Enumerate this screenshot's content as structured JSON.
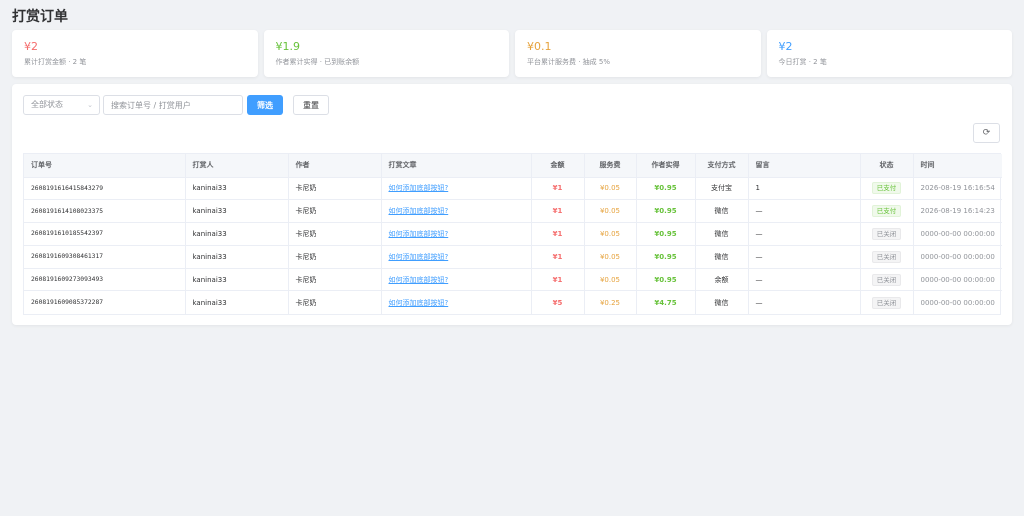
{
  "page": {
    "title": "打赏订单"
  },
  "stats": [
    {
      "value": "¥2",
      "desc": "累计打赏金额 · 2 笔",
      "color": "#f56c6c"
    },
    {
      "value": "¥1.9",
      "desc": "作者累计实得 · 已到账余额",
      "color": "#67c23a"
    },
    {
      "value": "¥0.1",
      "desc": "平台累计服务费 · 抽成 5%",
      "color": "#e6a23c"
    },
    {
      "value": "¥2",
      "desc": "今日打赏 · 2 笔",
      "color": "#409eff"
    }
  ],
  "filters": {
    "status_selected": "全部状态",
    "search_placeholder": "搜索订单号 / 打赏用户",
    "search_value": "",
    "filter_label": "筛选",
    "reset_label": "重置",
    "refresh_icon": "refresh-icon"
  },
  "table": {
    "columns": [
      "订单号",
      "打赏人",
      "作者",
      "打赏文章",
      "金额",
      "服务费",
      "作者实得",
      "支付方式",
      "留言",
      "状态",
      "时间"
    ],
    "rows": [
      {
        "order_no": "2608191616415843279",
        "tipper": "kaninai33",
        "author": "卡尼奶",
        "article": "如何添加底部按钮?",
        "amount": "¥1",
        "fee": "¥0.05",
        "net": "¥0.95",
        "pay": "支付宝",
        "message": "1",
        "status": "已支付",
        "status_type": "paid",
        "time": "2026-08-19 16:16:54"
      },
      {
        "order_no": "2608191614108023375",
        "tipper": "kaninai33",
        "author": "卡尼奶",
        "article": "如何添加底部按钮?",
        "amount": "¥1",
        "fee": "¥0.05",
        "net": "¥0.95",
        "pay": "微信",
        "message": "—",
        "status": "已支付",
        "status_type": "paid",
        "time": "2026-08-19 16:14:23"
      },
      {
        "order_no": "2608191610185542397",
        "tipper": "kaninai33",
        "author": "卡尼奶",
        "article": "如何添加底部按钮?",
        "amount": "¥1",
        "fee": "¥0.05",
        "net": "¥0.95",
        "pay": "微信",
        "message": "—",
        "status": "已关闭",
        "status_type": "closed",
        "time": "0000-00-00 00:00:00"
      },
      {
        "order_no": "2608191609308461317",
        "tipper": "kaninai33",
        "author": "卡尼奶",
        "article": "如何添加底部按钮?",
        "amount": "¥1",
        "fee": "¥0.05",
        "net": "¥0.95",
        "pay": "微信",
        "message": "—",
        "status": "已关闭",
        "status_type": "closed",
        "time": "0000-00-00 00:00:00"
      },
      {
        "order_no": "2608191609273093493",
        "tipper": "kaninai33",
        "author": "卡尼奶",
        "article": "如何添加底部按钮?",
        "amount": "¥1",
        "fee": "¥0.05",
        "net": "¥0.95",
        "pay": "余额",
        "message": "—",
        "status": "已关闭",
        "status_type": "closed",
        "time": "0000-00-00 00:00:00"
      },
      {
        "order_no": "2608191609085372287",
        "tipper": "kaninai33",
        "author": "卡尼奶",
        "article": "如何添加底部按钮?",
        "amount": "¥5",
        "fee": "¥0.25",
        "net": "¥4.75",
        "pay": "微信",
        "message": "—",
        "status": "已关闭",
        "status_type": "closed",
        "time": "0000-00-00 00:00:00"
      }
    ]
  }
}
